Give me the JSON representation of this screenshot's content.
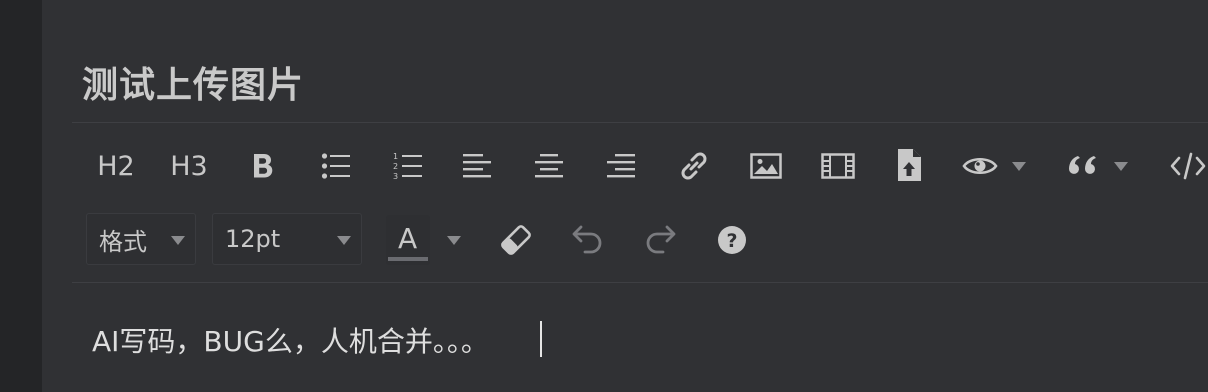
{
  "page_title": "测试上传图片",
  "toolbar_row1": {
    "h2_label": "H2",
    "h3_label": "H3",
    "items": [
      {
        "name": "bold",
        "icon": "bold-icon"
      },
      {
        "name": "bullet-list",
        "icon": "bullet-list-icon"
      },
      {
        "name": "numbered-list",
        "icon": "numbered-list-icon"
      },
      {
        "name": "align-left",
        "icon": "align-left-icon"
      },
      {
        "name": "align-center",
        "icon": "align-center-icon"
      },
      {
        "name": "align-right",
        "icon": "align-right-icon"
      },
      {
        "name": "link",
        "icon": "link-icon"
      },
      {
        "name": "image",
        "icon": "image-icon"
      },
      {
        "name": "video",
        "icon": "video-icon"
      },
      {
        "name": "file-upload",
        "icon": "file-upload-icon"
      },
      {
        "name": "preview",
        "icon": "eye-icon"
      },
      {
        "name": "quote",
        "icon": "quote-icon"
      },
      {
        "name": "code",
        "icon": "code-icon"
      }
    ]
  },
  "toolbar_row2": {
    "format_label": "格式",
    "font_size_value": "12pt",
    "font_color_letter": "A",
    "icons": [
      "eraser-icon",
      "undo-icon",
      "redo-icon",
      "help-icon"
    ]
  },
  "content": {
    "text": "AI写码，BUG么，人机合并。。。"
  },
  "colors": {
    "background": "#303134",
    "left_strip": "#242527",
    "icon": "#c8c8c8",
    "disabled_icon": "#7a7b7f"
  }
}
